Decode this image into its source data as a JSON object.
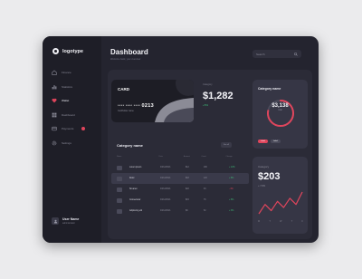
{
  "colors": {
    "accent_red": "#e0455c",
    "accent_green": "#3fbf79",
    "bg_dark": "#24242f"
  },
  "sidebar": {
    "logo": "logotype",
    "items": [
      {
        "label": "Finance",
        "icon": "home-icon"
      },
      {
        "label": "Statistics",
        "icon": "chart-icon"
      },
      {
        "label": "Wallet",
        "icon": "heart-icon"
      },
      {
        "label": "Dashboard",
        "icon": "grid-icon"
      },
      {
        "label": "Payments",
        "icon": "card-icon"
      },
      {
        "label": "Settings",
        "icon": "gear-icon"
      }
    ],
    "user": {
      "name": "User Name",
      "sub": "administrator"
    }
  },
  "header": {
    "title": "Dashboard",
    "subtitle": "Welcome back, your overview",
    "search_placeholder": "Search"
  },
  "card": {
    "label": "CARD",
    "masked": "**** **** ****",
    "last4": "0213",
    "holder": "Cardholder name"
  },
  "balance": {
    "label": "Category",
    "value": "$1,282",
    "change": "+5%"
  },
  "category_card": {
    "title": "Category name",
    "amount": "$3,138",
    "sub": "total",
    "progress": 0.78,
    "pills": [
      "Label",
      "Label"
    ]
  },
  "stat_card": {
    "label": "Category",
    "value": "$203",
    "change": "+ 7.8%",
    "days": [
      "M",
      "T",
      "W",
      "T",
      "F"
    ],
    "series": [
      2,
      5,
      3,
      6,
      4,
      7,
      5,
      9
    ]
  },
  "table": {
    "title": "Category name",
    "button": "See all",
    "headers": [
      "Name",
      "Date",
      "Amount",
      "Count",
      "Change"
    ],
    "rows": [
      {
        "name": "Lorem ipsum",
        "date": "04/12/2021",
        "amount": "$12",
        "count": "180",
        "change": "+ 12%",
        "trend": "pos"
      },
      {
        "name": "Dolor",
        "date": "04/12/2021",
        "amount": "$18",
        "count": "120",
        "change": "+ 8%",
        "trend": "pos"
      },
      {
        "name": "Sit amet",
        "date": "04/12/2021",
        "amount": "$22",
        "count": "94",
        "change": "- 4%",
        "trend": "neg"
      },
      {
        "name": "Consectetur",
        "date": "04/12/2021",
        "amount": "$15",
        "count": "76",
        "change": "+ 6%",
        "trend": "pos"
      },
      {
        "name": "Adipiscing elit",
        "date": "04/12/2021",
        "amount": "$9",
        "count": "52",
        "change": "+ 3%",
        "trend": "pos"
      }
    ]
  }
}
